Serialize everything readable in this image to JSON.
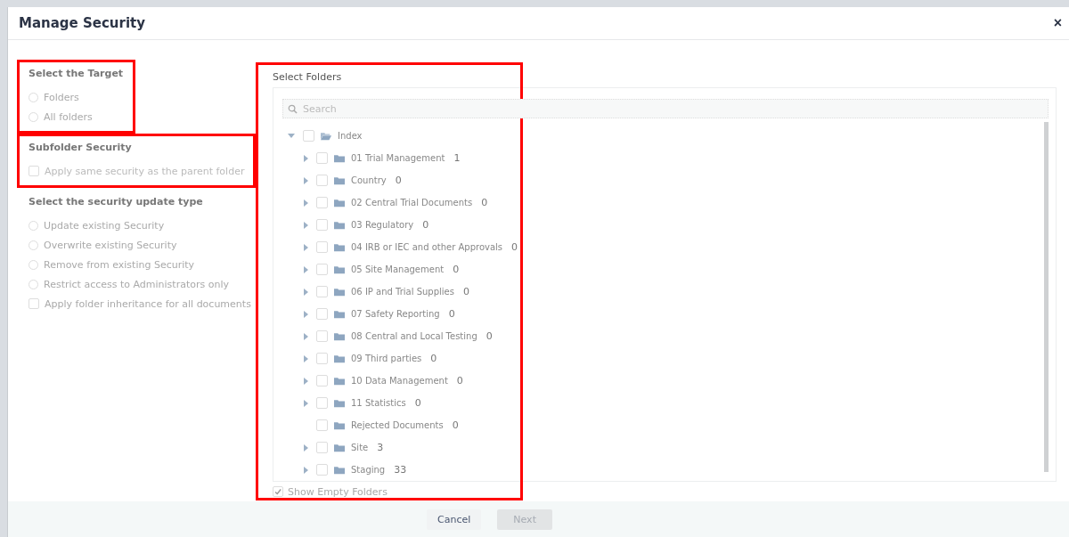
{
  "dialog": {
    "title": "Manage Security",
    "close": "×"
  },
  "target": {
    "heading": "Select the Target",
    "highlighted": true,
    "options": [
      {
        "label": "Folders",
        "selected": false
      },
      {
        "label": "All folders",
        "selected": false
      }
    ]
  },
  "subfolder": {
    "heading": "Subfolder Security",
    "highlighted": true,
    "option": {
      "label": "Apply same security as the parent folder",
      "checked": false,
      "disabled": true
    }
  },
  "update_type": {
    "heading": "Select the security update type",
    "options": [
      {
        "kind": "radio",
        "label": "Update existing Security",
        "selected": false
      },
      {
        "kind": "radio",
        "label": "Overwrite existing Security",
        "selected": false
      },
      {
        "kind": "radio",
        "label": "Remove from existing Security",
        "selected": false
      },
      {
        "kind": "radio",
        "label": "Restrict access to Administrators only",
        "selected": false
      },
      {
        "kind": "checkbox",
        "label": "Apply folder inheritance for all documents",
        "checked": false
      }
    ]
  },
  "folders": {
    "heading": "Select Folders",
    "highlighted": true,
    "search": {
      "placeholder": "Search"
    },
    "tree": [
      {
        "label": "Index",
        "checked": false,
        "expanded": true,
        "children": [
          {
            "label": "01 Trial Management",
            "count": "1",
            "checked": false,
            "has_children": true
          },
          {
            "label": "Country",
            "count": "0",
            "checked": false,
            "has_children": true
          },
          {
            "label": "02 Central Trial Documents",
            "count": "0",
            "checked": false,
            "has_children": true
          },
          {
            "label": "03 Regulatory",
            "count": "0",
            "checked": false,
            "has_children": true
          },
          {
            "label": "04 IRB or IEC and other Approvals",
            "count": "0",
            "checked": false,
            "has_children": true
          },
          {
            "label": "05 Site Management",
            "count": "0",
            "checked": false,
            "has_children": true
          },
          {
            "label": "06 IP and Trial Supplies",
            "count": "0",
            "checked": false,
            "has_children": true
          },
          {
            "label": "07 Safety Reporting",
            "count": "0",
            "checked": false,
            "has_children": true
          },
          {
            "label": "08 Central and Local Testing",
            "count": "0",
            "checked": false,
            "has_children": true
          },
          {
            "label": "09 Third parties",
            "count": "0",
            "checked": false,
            "has_children": true
          },
          {
            "label": "10 Data Management",
            "count": "0",
            "checked": false,
            "has_children": true
          },
          {
            "label": "11 Statistics",
            "count": "0",
            "checked": false,
            "has_children": true
          },
          {
            "label": "Rejected Documents",
            "count": "0",
            "checked": false,
            "has_children": false
          },
          {
            "label": "Site",
            "count": "3",
            "checked": false,
            "has_children": true
          },
          {
            "label": "Staging",
            "count": "33",
            "checked": false,
            "has_children": true
          }
        ]
      }
    ],
    "show_empty": {
      "label": "Show Empty Folders",
      "checked": true
    }
  },
  "buttons": [
    {
      "label": "Cancel",
      "disabled": false
    },
    {
      "label": "Next",
      "disabled": true
    }
  ]
}
